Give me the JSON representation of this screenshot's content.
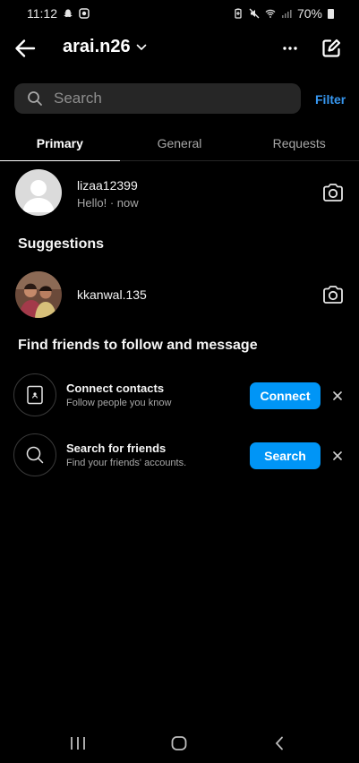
{
  "status_bar": {
    "time": "11:12",
    "battery": "70%"
  },
  "header": {
    "account": "arai.n26"
  },
  "search": {
    "placeholder": "Search",
    "filter_label": "Filter"
  },
  "tabs": [
    {
      "label": "Primary",
      "active": true
    },
    {
      "label": "General",
      "active": false
    },
    {
      "label": "Requests",
      "active": false
    }
  ],
  "messages": [
    {
      "username": "lizaa12399",
      "preview": "Hello! · now"
    }
  ],
  "suggestions": {
    "title": "Suggestions",
    "items": [
      {
        "username": "kkanwal.135"
      }
    ]
  },
  "find_friends": {
    "title": "Find friends to follow and message",
    "items": [
      {
        "title": "Connect contacts",
        "subtitle": "Follow people you know",
        "button": "Connect"
      },
      {
        "title": "Search for friends",
        "subtitle": "Find your friends' accounts.",
        "button": "Search"
      }
    ]
  },
  "colors": {
    "accent": "#0095f6",
    "link": "#3797f0",
    "background": "#000000",
    "surface": "#262626"
  }
}
